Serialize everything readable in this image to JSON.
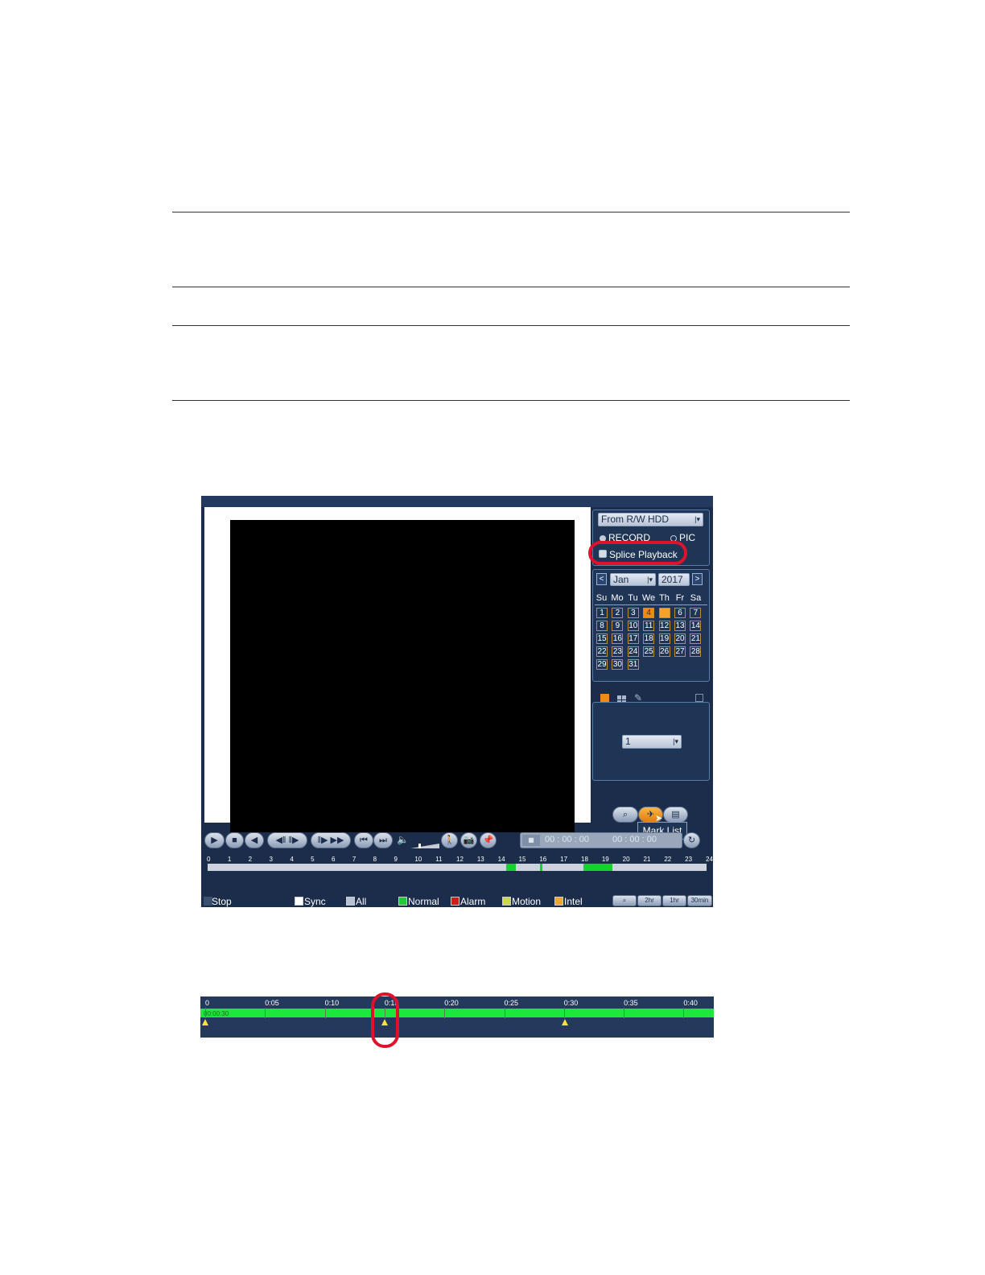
{
  "source": {
    "selected": "From R/W HDD",
    "record_label": "RECORD",
    "pic_label": "PIC",
    "splice_label": "Splice Playback"
  },
  "calendar": {
    "month": "Jan",
    "year": "2017",
    "prev": "<",
    "next": ">",
    "weekdays": [
      "Su",
      "Mo",
      "Tu",
      "We",
      "Th",
      "Fr",
      "Sa"
    ],
    "days": [
      "1",
      "2",
      "3",
      "4",
      "5",
      "6",
      "7",
      "8",
      "9",
      "10",
      "11",
      "12",
      "13",
      "14",
      "15",
      "16",
      "17",
      "18",
      "19",
      "20",
      "21",
      "22",
      "23",
      "24",
      "25",
      "26",
      "27",
      "28",
      "29",
      "30",
      "31"
    ],
    "recorded_days": [
      "4"
    ],
    "selected_day": "5"
  },
  "channel": {
    "selected": "1"
  },
  "tooltip": {
    "mark_list": "Mark List"
  },
  "time": {
    "start": "00 : 00 : 00",
    "end": "00 : 00 : 00"
  },
  "timeline": {
    "ticks": [
      "0",
      "1",
      "2",
      "3",
      "4",
      "5",
      "6",
      "7",
      "8",
      "9",
      "10",
      "11",
      "12",
      "13",
      "14",
      "15",
      "16",
      "17",
      "18",
      "19",
      "20",
      "21",
      "22",
      "23",
      "24"
    ]
  },
  "legend": {
    "stop": "Stop",
    "sync": "Sync",
    "all": "All",
    "normal": "Normal",
    "alarm": "Alarm",
    "motion": "Motion",
    "intel": "Intel",
    "zoom_2hr": "2hr",
    "zoom_1hr": "1hr",
    "zoom_30min": "30min"
  },
  "zoom_timeline": {
    "ticks": [
      "0",
      "0:05",
      "0:10",
      "0:15",
      "0:20",
      "0:25",
      "0:30",
      "0:35",
      "0:40"
    ],
    "current_time": "00:00:30"
  },
  "colors": {
    "record_green": "#17d12e",
    "highlight_red": "#e0112a",
    "panel_blue": "#1f3556",
    "mark_yellow": "#ffe040"
  }
}
